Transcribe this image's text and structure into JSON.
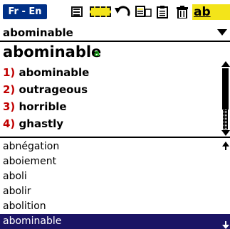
{
  "toolbar": {
    "lang_tab": "Fr - En",
    "icons": [
      "list-icon",
      "highlight-icon",
      "back-arrow-icon",
      "history-icon",
      "clipboard-icon",
      "trash-icon",
      "font-icon"
    ],
    "font_label": "ab",
    "accent_color": "#003087",
    "highlight_color": "#f3e41a"
  },
  "search": {
    "value": "abominable"
  },
  "entry": {
    "headword": "abominable",
    "pos": "a",
    "senses": [
      {
        "num": "1)",
        "text": "abominable"
      },
      {
        "num": "2)",
        "text": "outrageous"
      },
      {
        "num": "3)",
        "text": "horrible"
      },
      {
        "num": "4)",
        "text": "ghastly"
      }
    ]
  },
  "word_list": {
    "items": [
      "abnégation",
      "aboiement",
      "aboli",
      "abolir",
      "abolition",
      "abominable"
    ],
    "selected_index": 5,
    "selected_color": "#1b1464"
  }
}
